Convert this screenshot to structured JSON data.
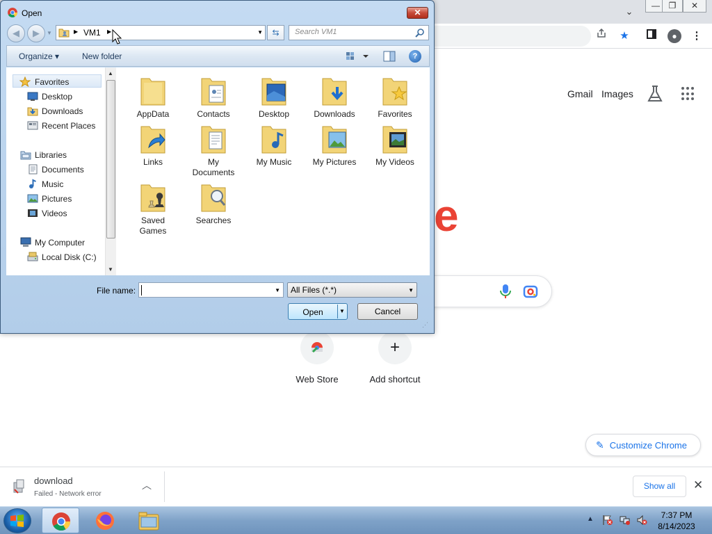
{
  "browser": {
    "window_controls": {
      "minimize": "—",
      "restore": "❐",
      "close": "✕"
    },
    "tab_search": "⌄",
    "toolbar_icons": [
      "share-icon",
      "bookmark-star-icon",
      "side-panel-icon",
      "profile-icon",
      "menu-icon"
    ],
    "header_links": {
      "gmail": "Gmail",
      "images": "Images"
    },
    "logo_fragment": "e",
    "shortcuts": [
      {
        "label": "Web Store",
        "icon": "web-store-icon"
      },
      {
        "label": "Add shortcut",
        "icon": "+"
      }
    ],
    "customize_label": "Customize Chrome",
    "accent_color": "#1a73e8",
    "download": {
      "name": "download",
      "status": "Failed - Network error",
      "show_all": "Show all"
    }
  },
  "dialog": {
    "title": "Open",
    "address": {
      "crumb": "VM1"
    },
    "search_placeholder": "Search VM1",
    "toolbar": {
      "organize": "Organize ▾",
      "new_folder": "New folder",
      "help": "?"
    },
    "nav_items": [
      {
        "label": "Favorites",
        "icon": "favorites-star-icon"
      },
      {
        "label": "Desktop",
        "icon": "desktop-icon"
      },
      {
        "label": "Downloads",
        "icon": "downloads-icon"
      },
      {
        "label": "Recent Places",
        "icon": "recent-places-icon"
      },
      {
        "label": "Libraries",
        "icon": "libraries-icon"
      },
      {
        "label": "Documents",
        "icon": "documents-icon"
      },
      {
        "label": "Music",
        "icon": "music-icon"
      },
      {
        "label": "Pictures",
        "icon": "pictures-icon"
      },
      {
        "label": "Videos",
        "icon": "videos-icon"
      },
      {
        "label": "My Computer",
        "icon": "computer-icon"
      },
      {
        "label": "Local Disk (C:)",
        "icon": "disk-icon"
      }
    ],
    "files": [
      {
        "line1": "AppData",
        "line2": ""
      },
      {
        "line1": "Contacts",
        "line2": ""
      },
      {
        "line1": "Desktop",
        "line2": ""
      },
      {
        "line1": "Downloads",
        "line2": ""
      },
      {
        "line1": "Favorites",
        "line2": ""
      },
      {
        "line1": "Links",
        "line2": ""
      },
      {
        "line1": "My",
        "line2": "Documents"
      },
      {
        "line1": "My Music",
        "line2": ""
      },
      {
        "line1": "My Pictures",
        "line2": ""
      },
      {
        "line1": "My Videos",
        "line2": ""
      },
      {
        "line1": "Saved",
        "line2": "Games"
      },
      {
        "line1": "Searches",
        "line2": ""
      }
    ],
    "filename_label": "File name:",
    "filename_value": "",
    "filetype": "All Files (*.*)",
    "open_label": "Open",
    "cancel_label": "Cancel"
  },
  "taskbar": {
    "time": "7:37 PM",
    "date": "8/14/2023",
    "apps": [
      "chrome-icon",
      "firefox-icon",
      "file-explorer-icon"
    ]
  }
}
